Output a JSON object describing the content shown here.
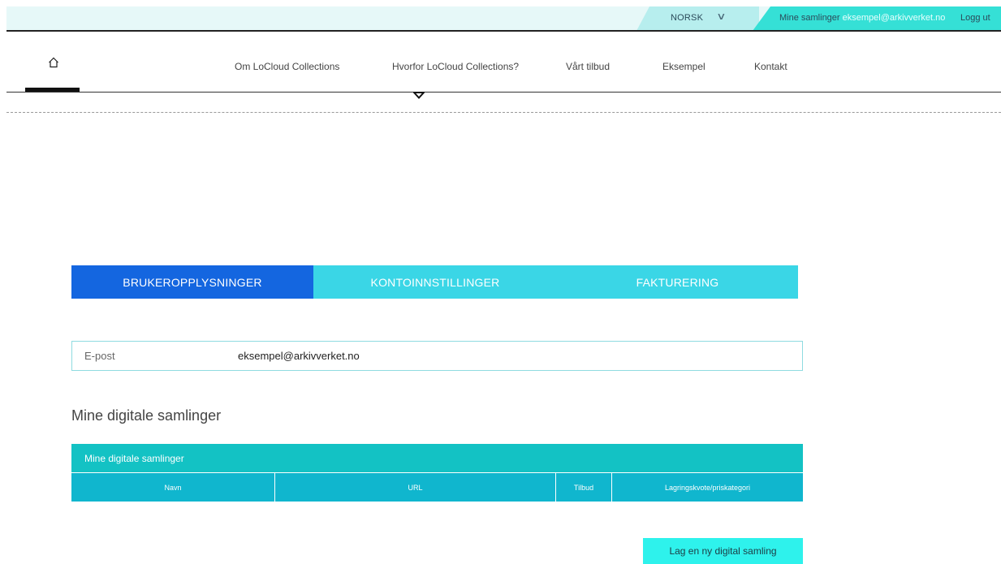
{
  "topbar": {
    "language": "NORSK",
    "my_collections_label": "Mine samlinger",
    "user_email": "eksempel@arkivverket.no",
    "logout_label": "Logg ut"
  },
  "nav": {
    "items": [
      "Om LoCloud Collections",
      "Hvorfor LoCloud Collections?",
      "Vårt tilbud",
      "Eksempel",
      "Kontakt"
    ]
  },
  "tabs": [
    {
      "label": "BRUKEROPPLYSNINGER",
      "active": true
    },
    {
      "label": "KONTOINNSTILLINGER",
      "active": false
    },
    {
      "label": "FAKTURERING",
      "active": false
    }
  ],
  "account": {
    "email_label": "E-post",
    "email_value": "eksempel@arkivverket.no"
  },
  "collections": {
    "section_title": "Mine digitale samlinger",
    "table_caption": "Mine digitale samlinger",
    "columns": [
      "Navn",
      "URL",
      "Tilbud",
      "Lagringskvote/priskategori"
    ],
    "rows": []
  },
  "actions": {
    "new_collection_label": "Lag en ny digital samling"
  },
  "colors": {
    "accent_blue": "#1466e0",
    "accent_cyan": "#3ad6e6",
    "table_teal": "#13c2c4",
    "button_aqua": "#2ef2ec"
  }
}
